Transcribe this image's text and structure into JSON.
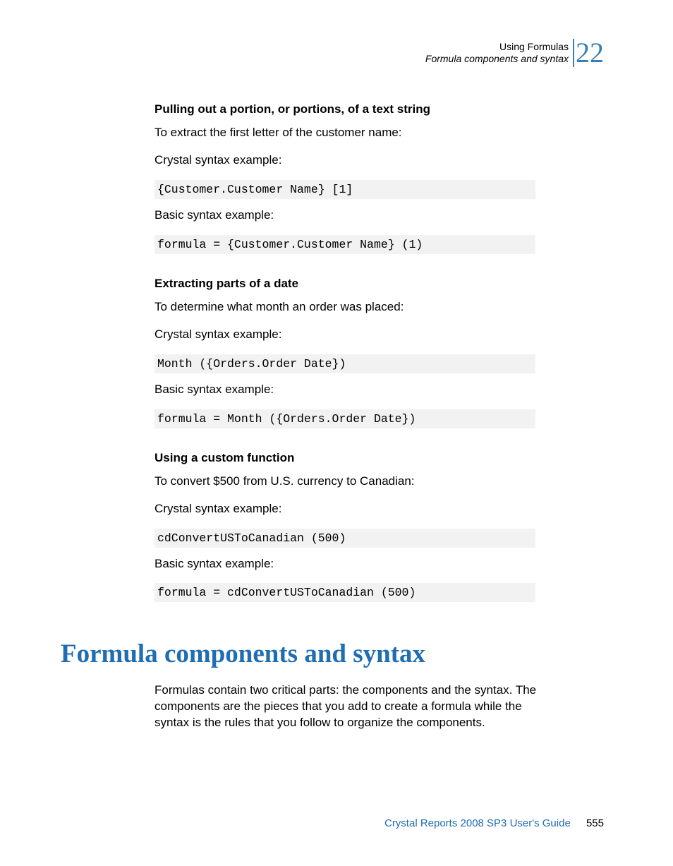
{
  "header": {
    "chapter_title": "Using Formulas",
    "section_title": "Formula components and syntax",
    "chapter_number": "22"
  },
  "sections": [
    {
      "heading": "Pulling out a portion, or portions, of a text string",
      "intro": "To extract the first letter of the customer name:",
      "crystal_label": "Crystal syntax example:",
      "crystal_code": "{Customer.Customer Name} [1]",
      "basic_label": "Basic syntax example:",
      "basic_code": "formula = {Customer.Customer Name} (1)"
    },
    {
      "heading": "Extracting parts of a date",
      "intro": "To determine what month an order was placed:",
      "crystal_label": "Crystal syntax example:",
      "crystal_code": "Month ({Orders.Order Date})",
      "basic_label": "Basic syntax example:",
      "basic_code": "formula = Month ({Orders.Order Date})"
    },
    {
      "heading": "Using a custom function",
      "intro": "To convert $500 from U.S. currency to Canadian:",
      "crystal_label": "Crystal syntax example:",
      "crystal_code": "cdConvertUSToCanadian (500)",
      "basic_label": "Basic syntax example:",
      "basic_code": "formula = cdConvertUSToCanadian (500)"
    }
  ],
  "main_heading": "Formula components and syntax",
  "main_body": "Formulas contain two critical parts: the components and the syntax. The components are the pieces that you add to create a formula while the syntax is the rules that you follow to organize the components.",
  "footer": {
    "guide": "Crystal Reports 2008 SP3 User's Guide",
    "page": "555"
  }
}
